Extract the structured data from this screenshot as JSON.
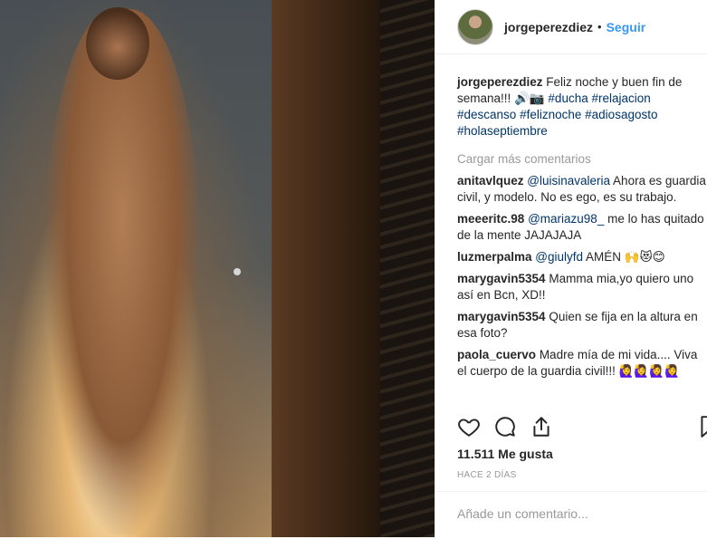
{
  "post": {
    "username": "jorgeperezdiez",
    "follow_label": "Seguir",
    "separator": "•",
    "caption_text": "Feliz noche y buen fin de semana!!! 🔊📷",
    "hashtags": [
      "#ducha",
      "#relajacion",
      "#descanso",
      "#feliznoche",
      "#adiosagosto",
      "#holaseptiembre"
    ],
    "load_more": "Cargar más comentarios",
    "likes": "11.511 Me gusta",
    "time_ago": "HACE 2 DÍAS",
    "add_comment_placeholder": "Añade un comentario..."
  },
  "comments": [
    {
      "user": "anitavlquez",
      "mention": "@luisinavaleria",
      "text": " Ahora es guardia civil, y modelo. No es ego, es su trabajo."
    },
    {
      "user": "meeeritc.98",
      "mention": "@mariazu98_",
      "text": " me lo has quitado de la mente JAJAJAJA"
    },
    {
      "user": "luzmerpalma",
      "mention": "@giulyfd",
      "text": " AMÉN 🙌😻😊"
    },
    {
      "user": "marygavin5354",
      "mention": "",
      "text": "Mamma mia,yo quiero uno así en Bcn, XD!!"
    },
    {
      "user": "marygavin5354",
      "mention": "",
      "text": "Quien se fija en la altura en esa foto?"
    },
    {
      "user": "paola_cuervo",
      "mention": "",
      "text": "Madre mía de mi vida.... Viva el cuerpo de la guardia civil!!! 🙋‍♀️🙋‍♀️🙋‍♀️🙋‍♀️"
    }
  ],
  "icons": [
    "heart-icon",
    "comment-icon",
    "share-icon",
    "bookmark-icon"
  ],
  "colors": {
    "link": "#003569",
    "follow": "#3897f0",
    "muted": "#999999"
  }
}
